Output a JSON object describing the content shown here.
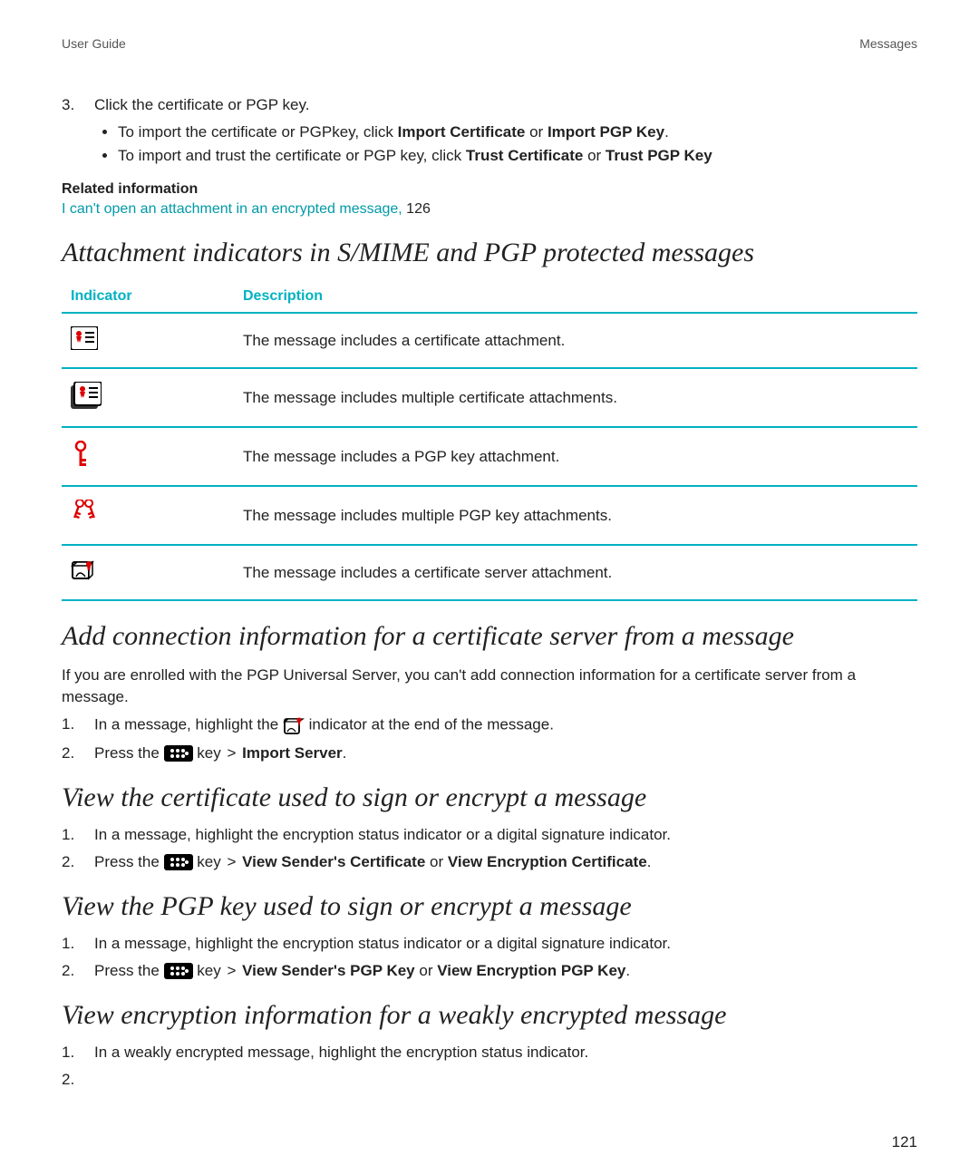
{
  "header": {
    "left": "User Guide",
    "right": "Messages"
  },
  "step3": {
    "num": "3.",
    "text": "Click the certificate or PGP key.",
    "sub1_prefix": "To import the certificate or PGPkey, click ",
    "sub1_b1": "Import Certificate",
    "sub1_mid": " or ",
    "sub1_b2": "Import PGP Key",
    "sub1_suffix": ".",
    "sub2_prefix": "To import and trust the certificate or PGP key, click ",
    "sub2_b1": "Trust Certificate",
    "sub2_mid": " or ",
    "sub2_b2": "Trust PGP Key"
  },
  "related": {
    "heading": "Related information",
    "link_text": "I can't open an attachment in an encrypted message,",
    "link_page": " 126"
  },
  "sec1": {
    "title": "Attachment indicators in S/MIME and PGP protected messages",
    "th_indicator": "Indicator",
    "th_description": "Description",
    "rows": [
      {
        "desc": "The message includes a certificate attachment."
      },
      {
        "desc": "The message includes multiple certificate attachments."
      },
      {
        "desc": "The message includes a PGP key attachment."
      },
      {
        "desc": "The message includes multiple PGP key attachments."
      },
      {
        "desc": "The message includes a certificate server attachment."
      }
    ]
  },
  "sec2": {
    "title": "Add connection information for a certificate server from a message",
    "intro": "If you are enrolled with the PGP Universal Server, you can't add connection information for a certificate server from a message.",
    "s1_num": "1.",
    "s1_pre": "In a message, highlight the ",
    "s1_post": " indicator at the end of the message.",
    "s2_num": "2.",
    "s2_pre": "Press the ",
    "s2_key_word": " key",
    "gt": " > ",
    "s2_b1": "Import Server",
    "s2_suffix": "."
  },
  "sec3": {
    "title": "View the certificate used to sign or encrypt a message",
    "s1_num": "1.",
    "s1_text": "In a message, highlight the encryption status indicator or a digital signature indicator.",
    "s2_num": "2.",
    "s2_pre": "Press the ",
    "s2_key_word": " key",
    "gt": " > ",
    "s2_b1": "View Sender's Certificate",
    "s2_mid": " or ",
    "s2_b2": "View Encryption Certificate",
    "s2_suffix": "."
  },
  "sec4": {
    "title": "View the PGP key used to sign or encrypt a message",
    "s1_num": "1.",
    "s1_text": "In a message, highlight the encryption status indicator or a digital signature indicator.",
    "s2_num": "2.",
    "s2_pre": "Press the ",
    "s2_key_word": " key",
    "gt": " > ",
    "s2_b1": "View Sender's PGP Key",
    "s2_mid": " or ",
    "s2_b2": "View Encryption PGP Key",
    "s2_suffix": "."
  },
  "sec5": {
    "title": "View encryption information for a weakly encrypted message",
    "s1_num": "1.",
    "s1_text": "In a weakly encrypted message, highlight the encryption status indicator.",
    "s2_num": "2."
  },
  "footer": {
    "page_number": "121"
  }
}
